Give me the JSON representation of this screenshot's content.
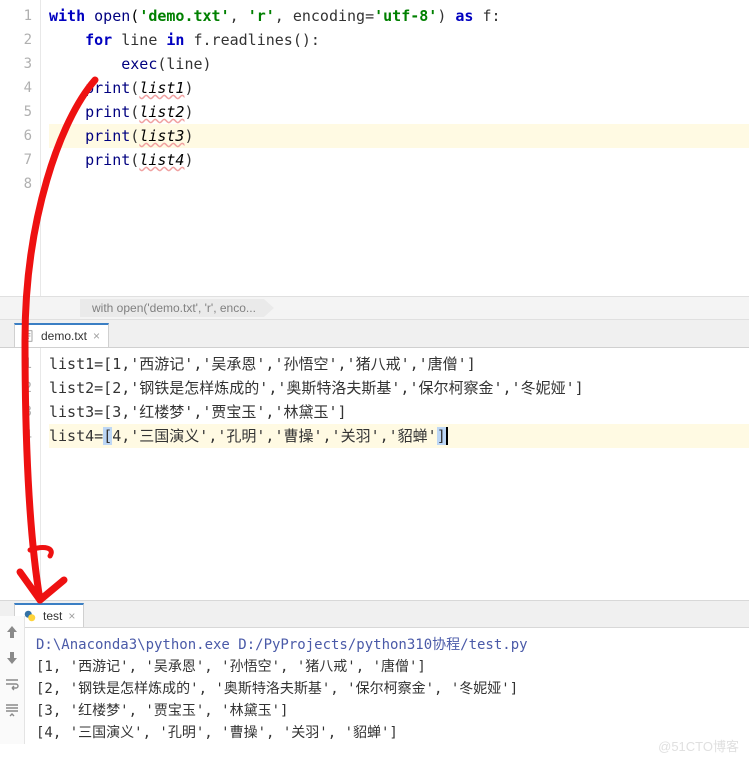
{
  "gutter": {
    "lines": [
      "1",
      "2",
      "3",
      "4",
      "5",
      "6",
      "7",
      "8"
    ]
  },
  "code": {
    "l1": {
      "kw1": "with",
      "fn": "open",
      "p1": "(",
      "s1": "'demo.txt'",
      "c1": ", ",
      "s2": "'r'",
      "c2": ", ",
      "arg": "encoding=",
      "s3": "'utf-8'",
      "p2": ") ",
      "kw2": "as",
      "id": " f",
      "p3": ":"
    },
    "l2": {
      "kw1": "for",
      "id1": " line ",
      "kw2": "in",
      "id2": " f.readlines()",
      "p": ":"
    },
    "l3": {
      "fn": "exec",
      "arg": "(line)"
    },
    "l4": {
      "fn": "print",
      "p1": "(",
      "v": "list1",
      "p2": ")"
    },
    "l5": {
      "fn": "print",
      "p1": "(",
      "v": "list2",
      "p2": ")"
    },
    "l6": {
      "fn": "print",
      "p1": "(",
      "v": "list3",
      "p2": ")"
    },
    "l7": {
      "fn": "print",
      "p1": "(",
      "v": "list4",
      "p2": ")"
    }
  },
  "crumb": "with open('demo.txt', 'r', enco...",
  "tabs": {
    "demo": "demo.txt",
    "bottom": "test"
  },
  "gutter2": {
    "lines": [
      "1",
      "2",
      "3",
      "4"
    ]
  },
  "demo": {
    "l1": "list1=[1,'西游记','吴承恩','孙悟空','猪八戒','唐僧']",
    "l2": "list2=[2,'钢铁是怎样炼成的','奥斯特洛夫斯基','保尔柯察金','冬妮娅']",
    "l3": "list3=[3,'红楼梦','贾宝玉','林黛玉']",
    "l4a": "list4=",
    "l4b": "[",
    "l4c": "4,'三国演义','孔明','曹操','关羽','貂蝉'",
    "l4d": "]"
  },
  "console": {
    "cmd": "D:\\Anaconda3\\python.exe D:/PyProjects/python310协程/test.py",
    "o1": "[1, '西游记', '吴承恩', '孙悟空', '猪八戒', '唐僧']",
    "o2": "[2, '钢铁是怎样炼成的', '奥斯特洛夫斯基', '保尔柯察金', '冬妮娅']",
    "o3": "[3, '红楼梦', '贾宝玉', '林黛玉']",
    "o4": "[4, '三国演义', '孔明', '曹操', '关羽', '貂蝉']"
  },
  "watermark": "@51CTO博客"
}
